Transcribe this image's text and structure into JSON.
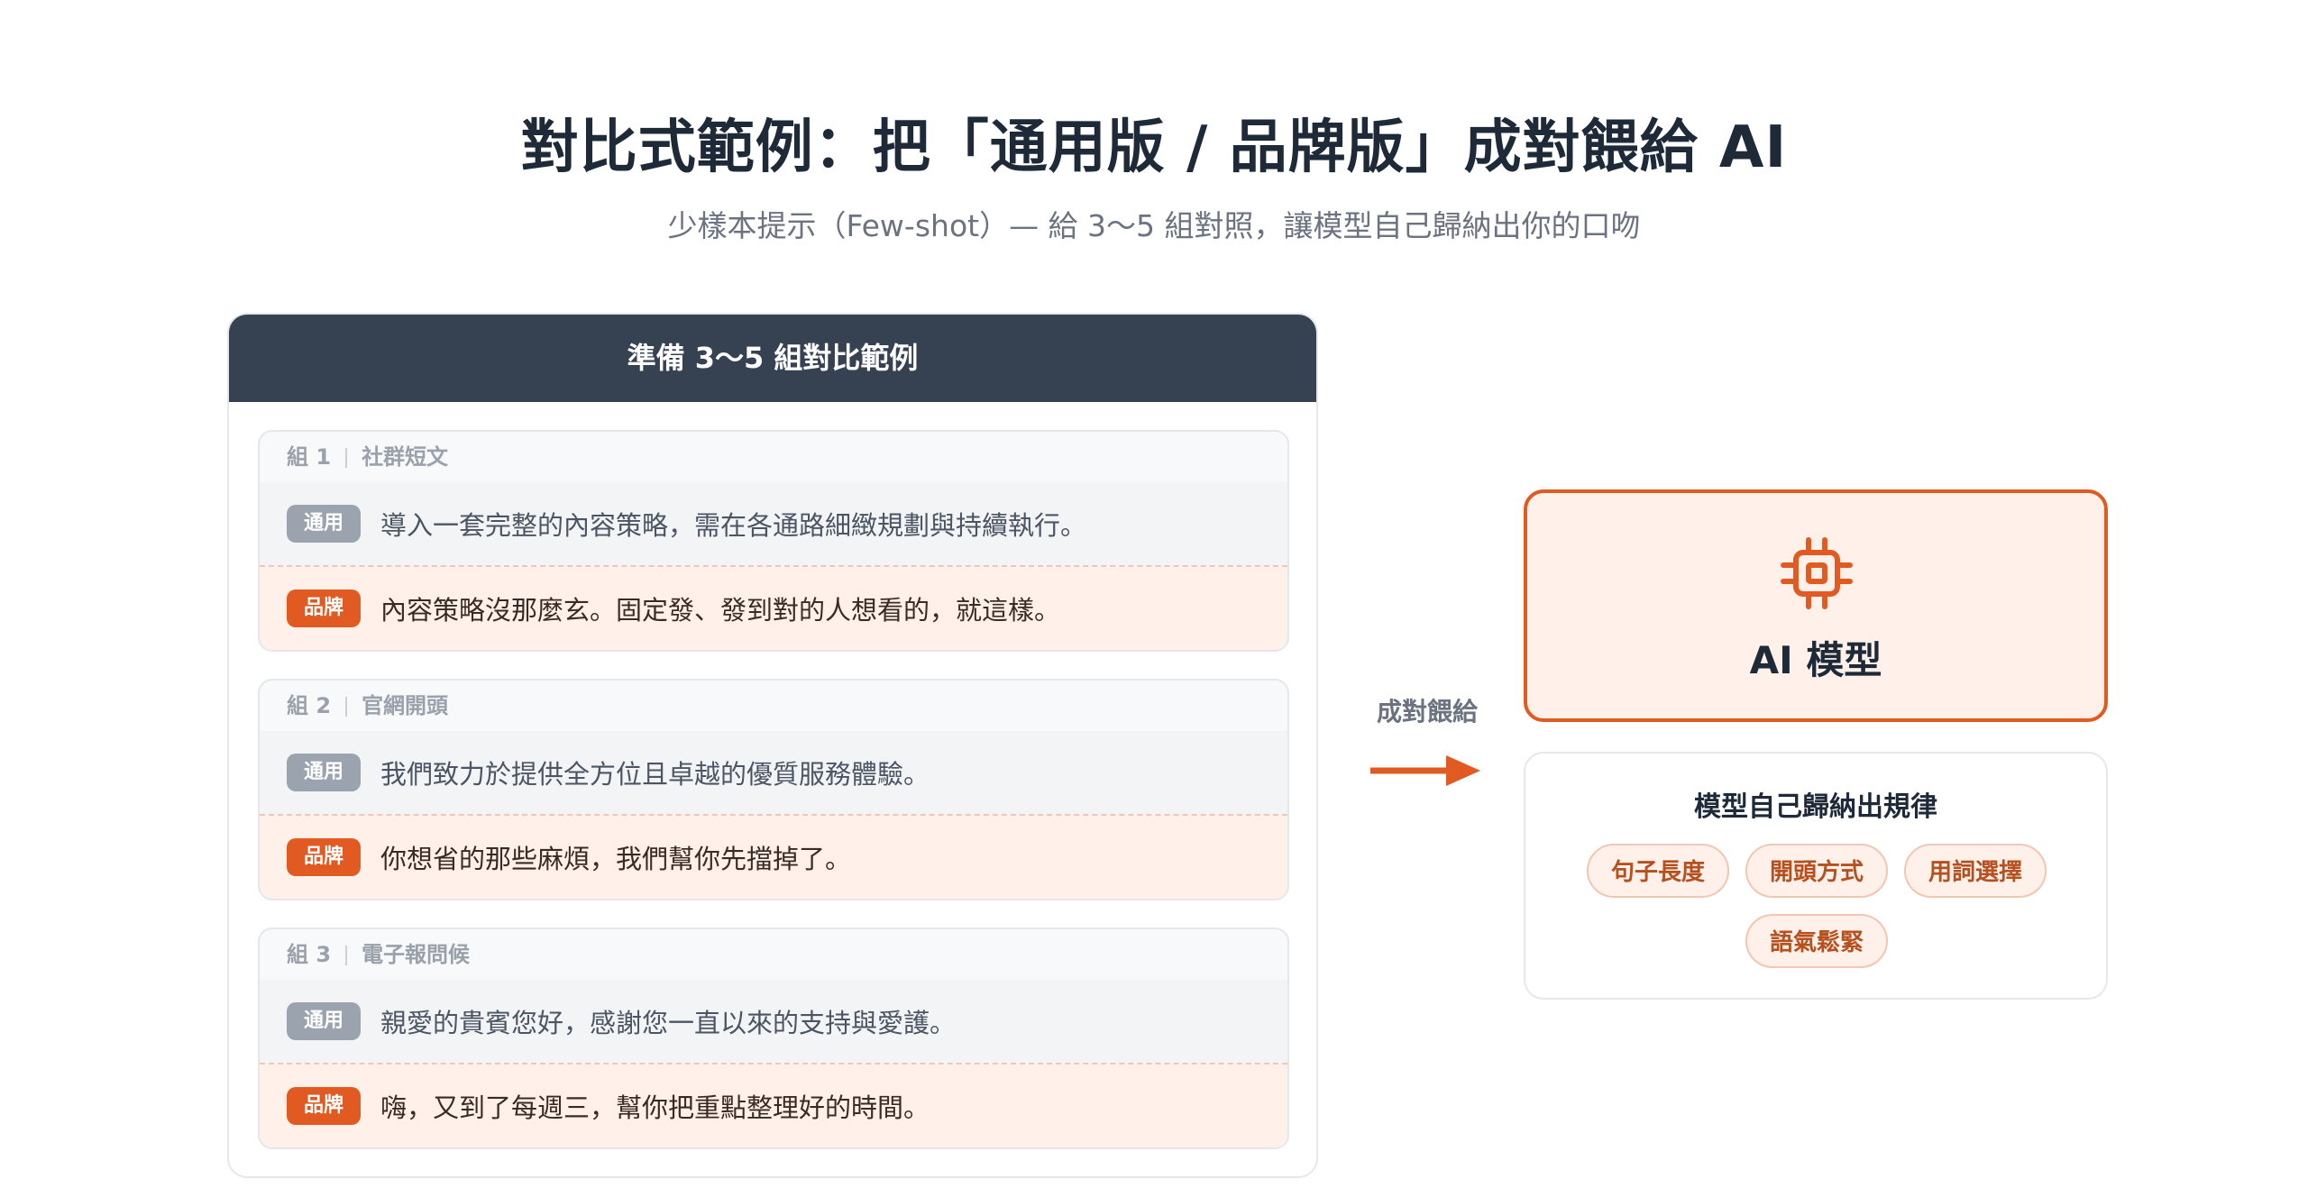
{
  "header": {
    "title": "對比式範例：把「通用版 / 品牌版」成對餵給 AI",
    "subtitle": "少樣本提示（Few-shot）— 給 3〜5 組對照，讓模型自己歸納出你的口吻"
  },
  "panel": {
    "title": "準備 3〜5 組對比範例",
    "groups": [
      {
        "label": "組 1",
        "category": "社群短文",
        "generic_tag": "通用",
        "generic_text": "導入一套完整的內容策略，需在各通路細緻規劃與持續執行。",
        "brand_tag": "品牌",
        "brand_text": "內容策略沒那麼玄。固定發、發到對的人想看的，就這樣。"
      },
      {
        "label": "組 2",
        "category": "官網開頭",
        "generic_tag": "通用",
        "generic_text": "我們致力於提供全方位且卓越的優質服務體驗。",
        "brand_tag": "品牌",
        "brand_text": "你想省的那些麻煩，我們幫你先擋掉了。"
      },
      {
        "label": "組 3",
        "category": "電子報問候",
        "generic_tag": "通用",
        "generic_text": "親愛的貴賓您好，感謝您一直以來的支持與愛護。",
        "brand_tag": "品牌",
        "brand_text": "嗨，又到了每週三，幫你把重點整理好的時間。"
      }
    ]
  },
  "arrow": {
    "label": "成對餵給"
  },
  "ai_model": {
    "icon": "chip-icon",
    "title": "AI 模型"
  },
  "rules": {
    "title": "模型自己歸納出規律",
    "chips": [
      "句子長度",
      "開頭方式",
      "用詞選擇",
      "語氣鬆緊"
    ]
  },
  "colors": {
    "accent": "#e05a22",
    "dark": "#364152",
    "brand_bg": "#fff1ea",
    "generic_bg": "#f3f4f6"
  }
}
